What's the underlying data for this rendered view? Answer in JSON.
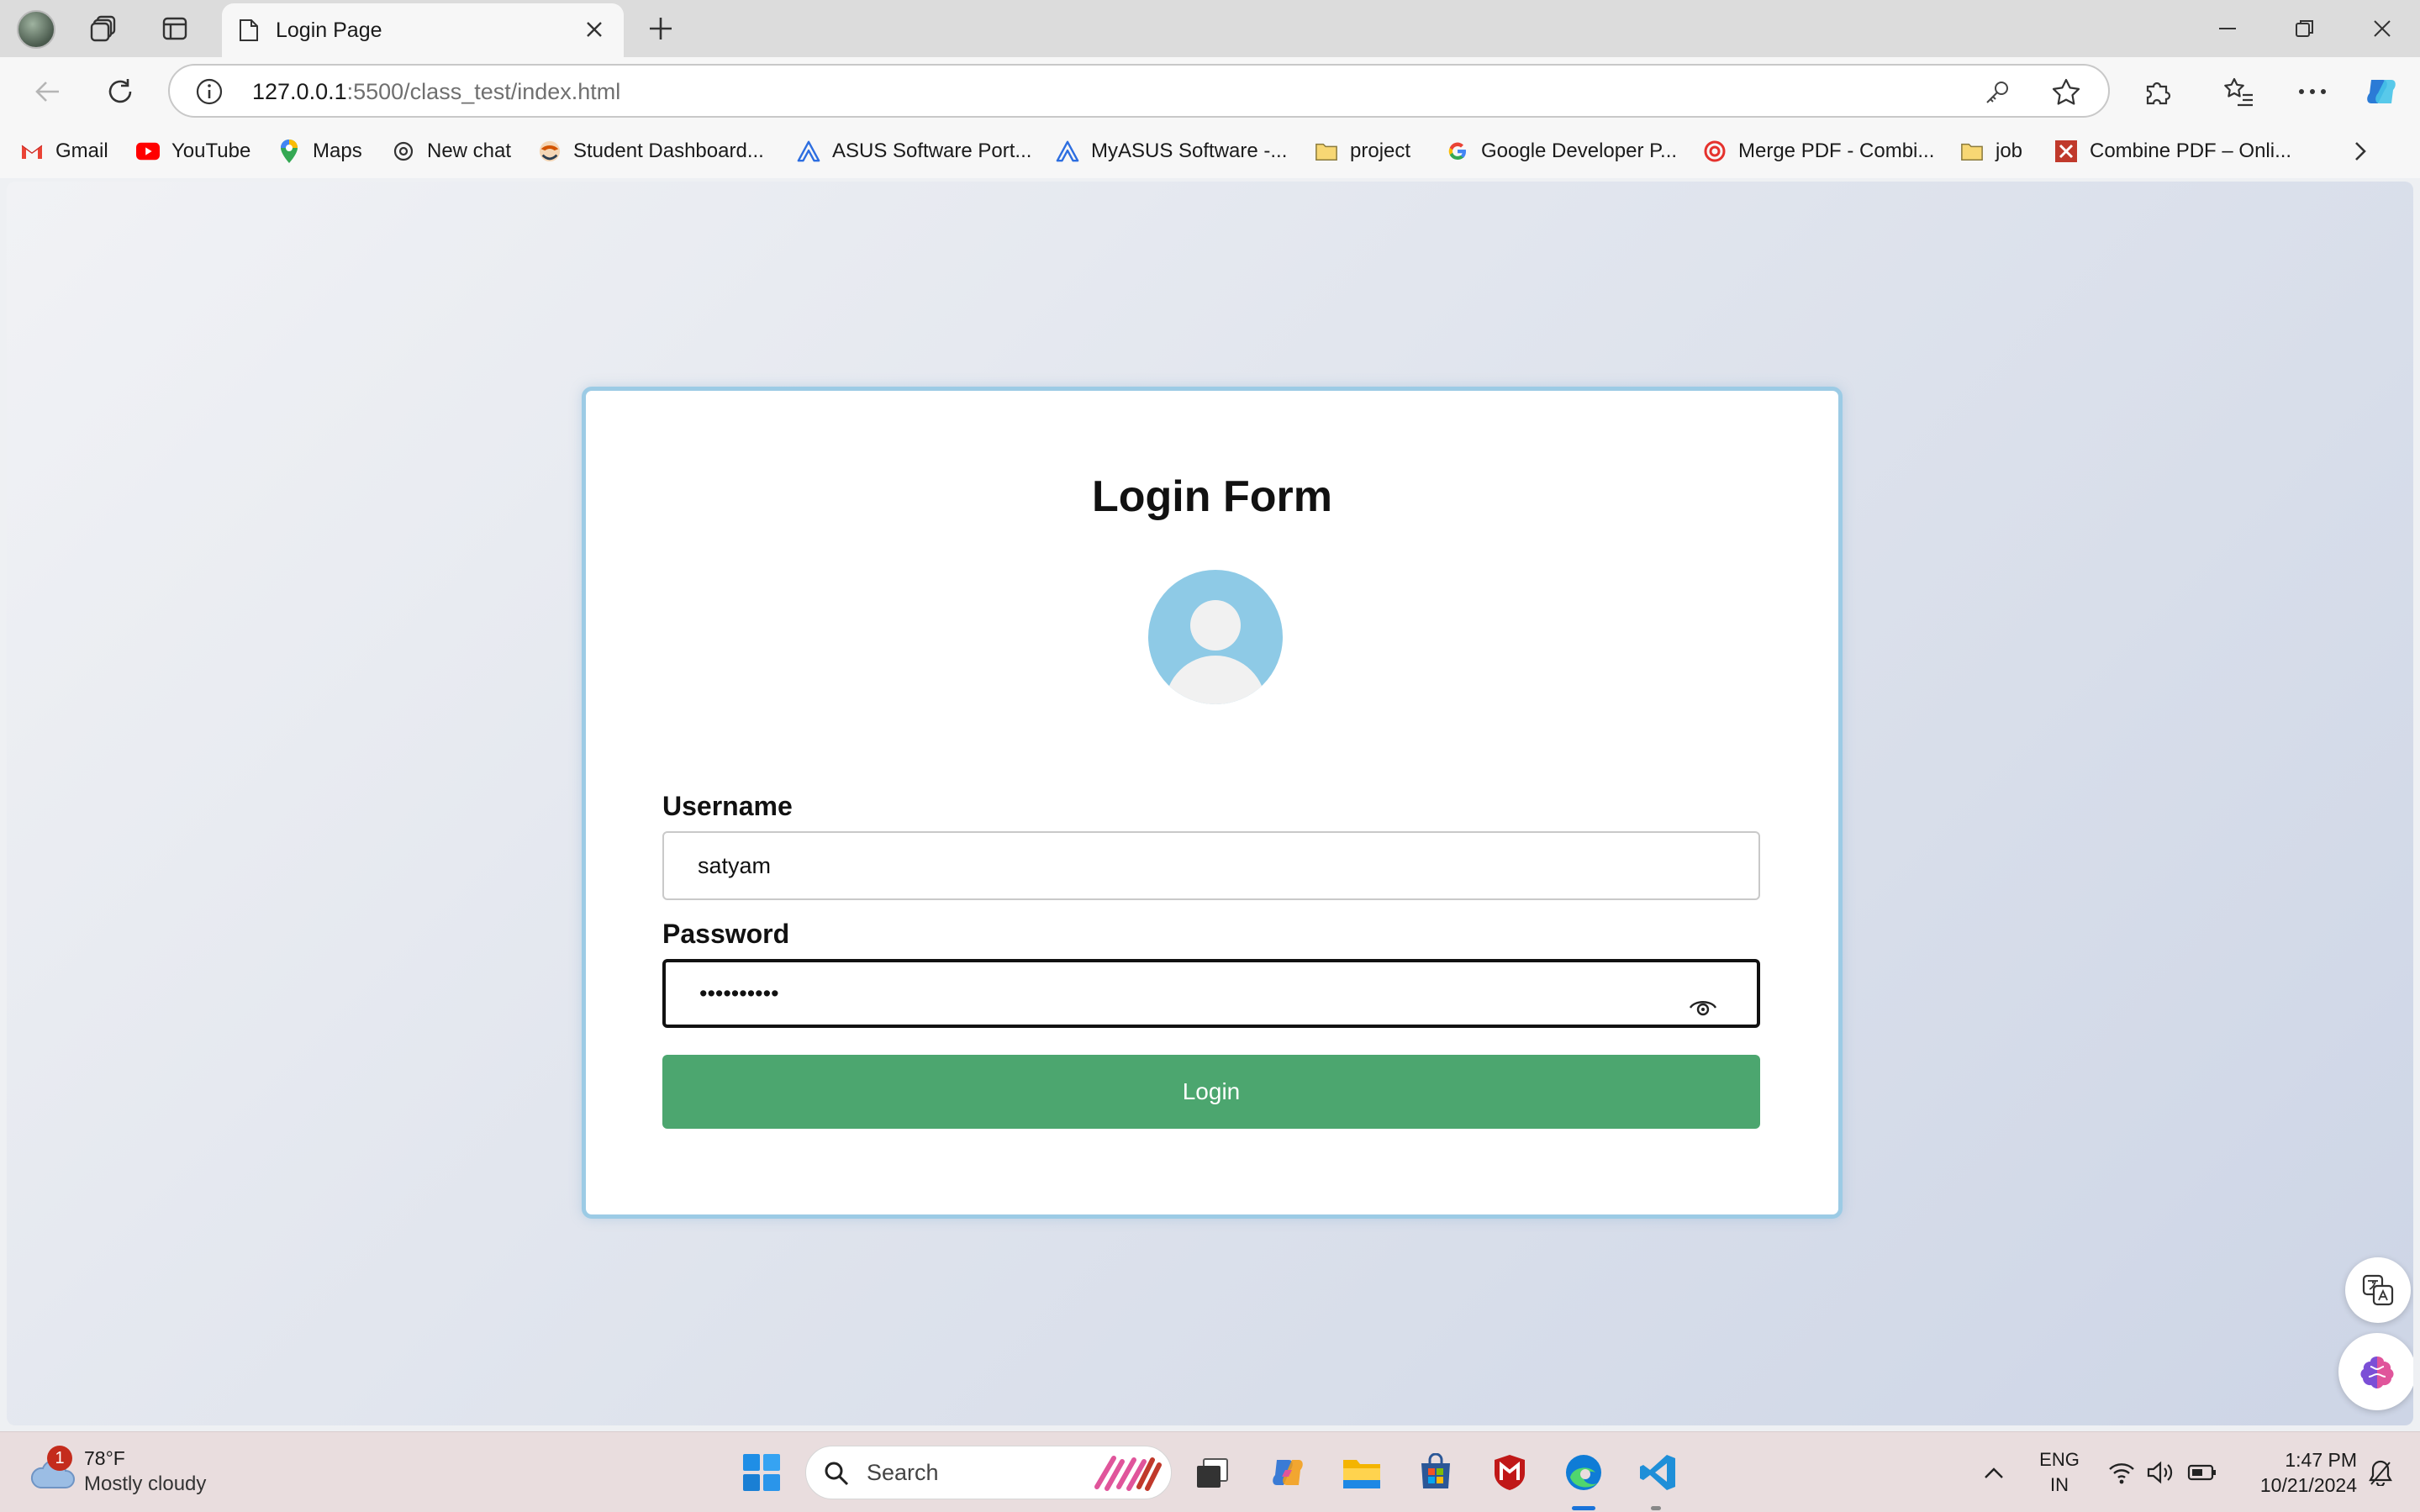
{
  "browser": {
    "tab": {
      "title": "Login Page"
    },
    "url": {
      "host": "127.0.0.1",
      "rest": ":5500/class_test/index.html"
    },
    "bookmarks": [
      {
        "label": "Gmail",
        "icon": "gmail-icon"
      },
      {
        "label": "YouTube",
        "icon": "youtube-icon"
      },
      {
        "label": "Maps",
        "icon": "maps-icon"
      },
      {
        "label": "New chat",
        "icon": "chatgpt-icon"
      },
      {
        "label": "Student Dashboard...",
        "icon": "dashboard-icon"
      },
      {
        "label": "ASUS Software Port...",
        "icon": "asus-icon"
      },
      {
        "label": "MyASUS Software -...",
        "icon": "asus-icon"
      },
      {
        "label": "project",
        "icon": "folder-icon"
      },
      {
        "label": "Google Developer P...",
        "icon": "google-icon"
      },
      {
        "label": "Merge PDF - Combi...",
        "icon": "pdf-merge-icon"
      },
      {
        "label": "job",
        "icon": "folder-icon"
      },
      {
        "label": "Combine PDF – Onli...",
        "icon": "pdf-combine-icon"
      }
    ]
  },
  "page": {
    "title": "Login Form",
    "username_label": "Username",
    "username_value": "satyam",
    "password_label": "Password",
    "password_value": "••••••••••",
    "login_label": "Login"
  },
  "taskbar": {
    "weather": {
      "temp": "78°F",
      "desc": "Mostly cloudy",
      "badge": "1"
    },
    "search_placeholder": "Search",
    "lang_line1": "ENG",
    "lang_line2": "IN",
    "time": "1:47 PM",
    "date": "10/21/2024"
  },
  "colors": {
    "accent_button": "#4ca66f",
    "card_border": "#9ccbe5",
    "avatar": "#8ecae6"
  }
}
